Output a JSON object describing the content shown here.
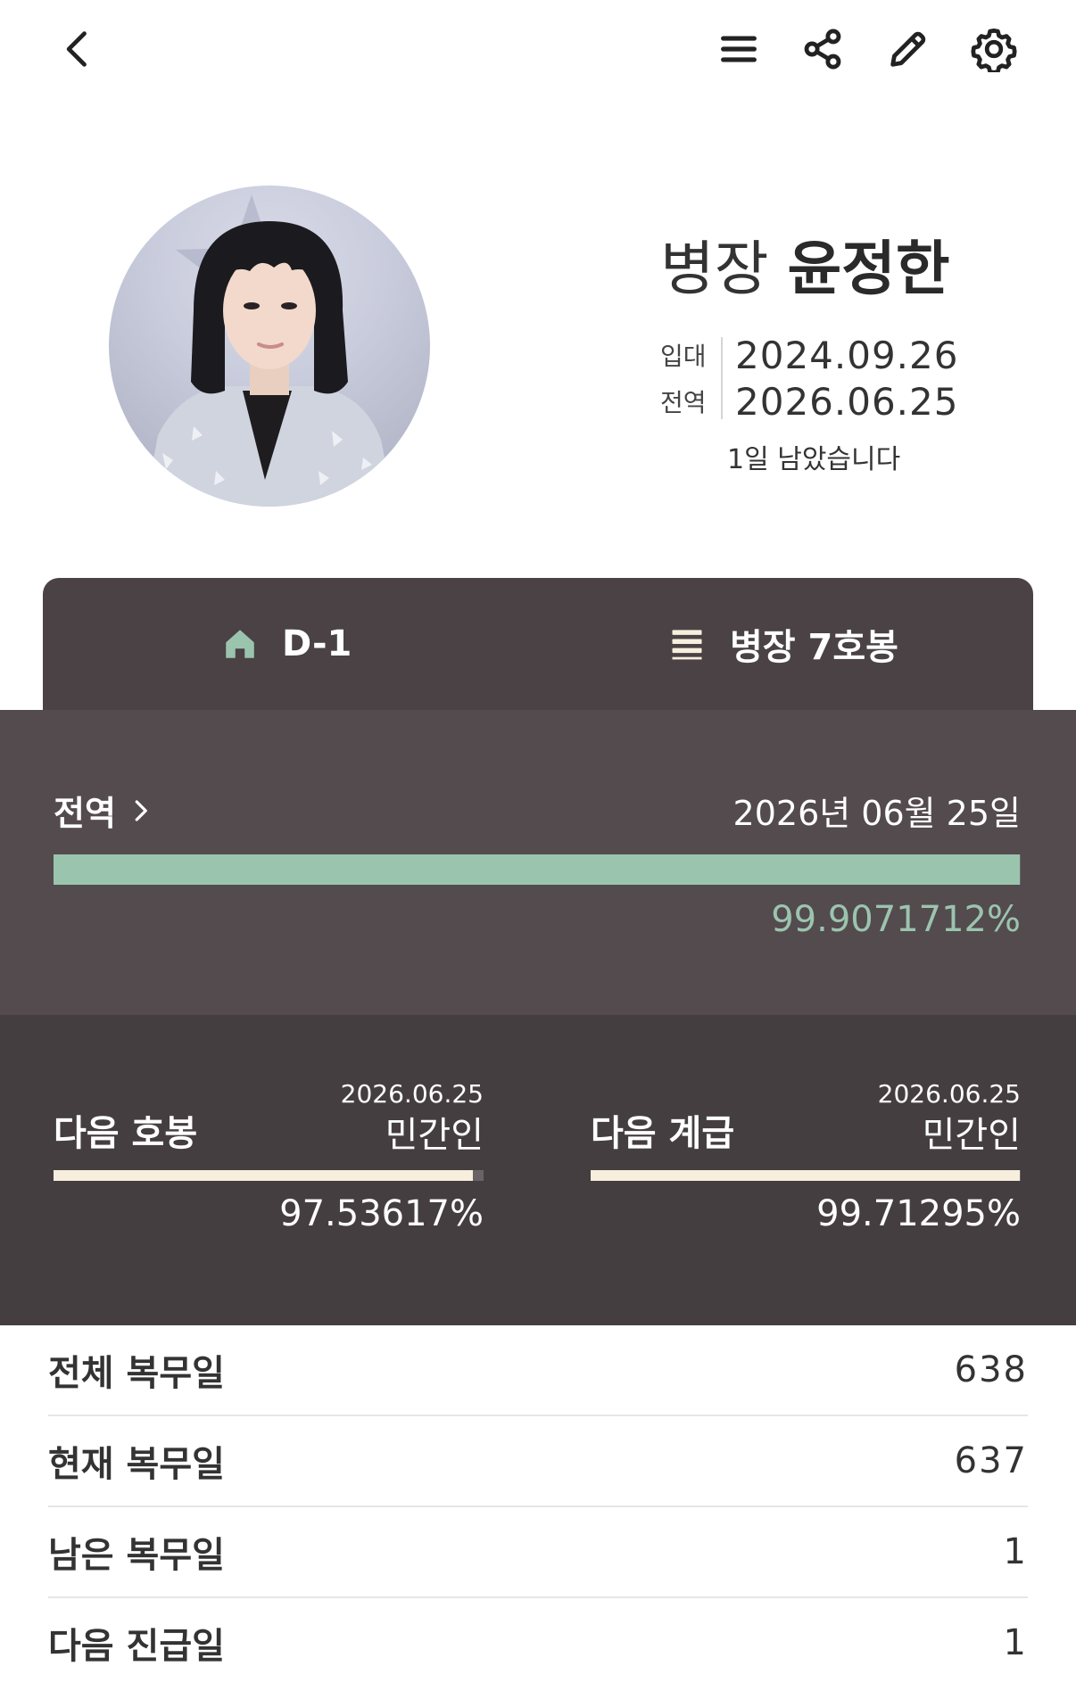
{
  "header": {
    "icons": [
      "back-icon",
      "menu-icon",
      "share-icon",
      "edit-icon",
      "settings-icon"
    ]
  },
  "profile": {
    "rank": "병장",
    "name": "윤정한",
    "enlist_label": "입대",
    "enlist_date": "2024.09.26",
    "discharge_label": "전역",
    "discharge_date": "2026.06.25",
    "remaining_text": "1일 남았습니다"
  },
  "tabs": [
    {
      "icon": "home-icon",
      "label": "D-1"
    },
    {
      "icon": "list-icon",
      "label": "병장 7호봉"
    }
  ],
  "discharge_section": {
    "title": "전역",
    "date": "2026년 06월 25일",
    "percent_text": "99.9071712%",
    "progress": 0.999071712
  },
  "next_section": [
    {
      "title": "다음 호봉",
      "date": "2026.06.25",
      "status": "민간인",
      "percent_text": "97.53617%",
      "progress": 0.9753617
    },
    {
      "title": "다음 계급",
      "date": "2026.06.25",
      "status": "민간인",
      "percent_text": "99.71295%",
      "progress": 0.9971295
    }
  ],
  "stats": [
    {
      "label": "전체 복무일",
      "value": "638"
    },
    {
      "label": "현재 복무일",
      "value": "637"
    },
    {
      "label": "남은 복무일",
      "value": "1"
    },
    {
      "label": "다음 진급일",
      "value": "1"
    }
  ],
  "colors": {
    "accent_green": "#9bc4ae",
    "tab_bg": "#4a4244",
    "discharge_bg": "#544b4e",
    "next_bg": "#453e40",
    "bar_cream": "#f8eedd"
  }
}
